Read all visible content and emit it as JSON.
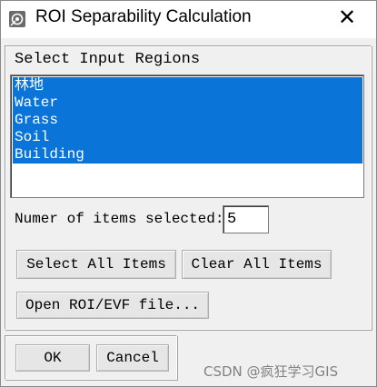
{
  "window": {
    "title": "ROI Separability Calculation",
    "close_glyph": "✕"
  },
  "regions": {
    "label": "Select Input Regions",
    "items": [
      {
        "label": "林地",
        "selected": true
      },
      {
        "label": "Water",
        "selected": true
      },
      {
        "label": "Grass",
        "selected": true
      },
      {
        "label": "Soil",
        "selected": true
      },
      {
        "label": "Building",
        "selected": true
      }
    ],
    "selection_color": "#0a74d9"
  },
  "count": {
    "label": "Numer of items selected:",
    "value": "5"
  },
  "buttons": {
    "select_all": "Select All Items",
    "clear_all": "Clear All Items",
    "open_file": "Open ROI/EVF file...",
    "ok": "OK",
    "cancel": "Cancel"
  },
  "watermark": "CSDN @疯狂学习GIS"
}
